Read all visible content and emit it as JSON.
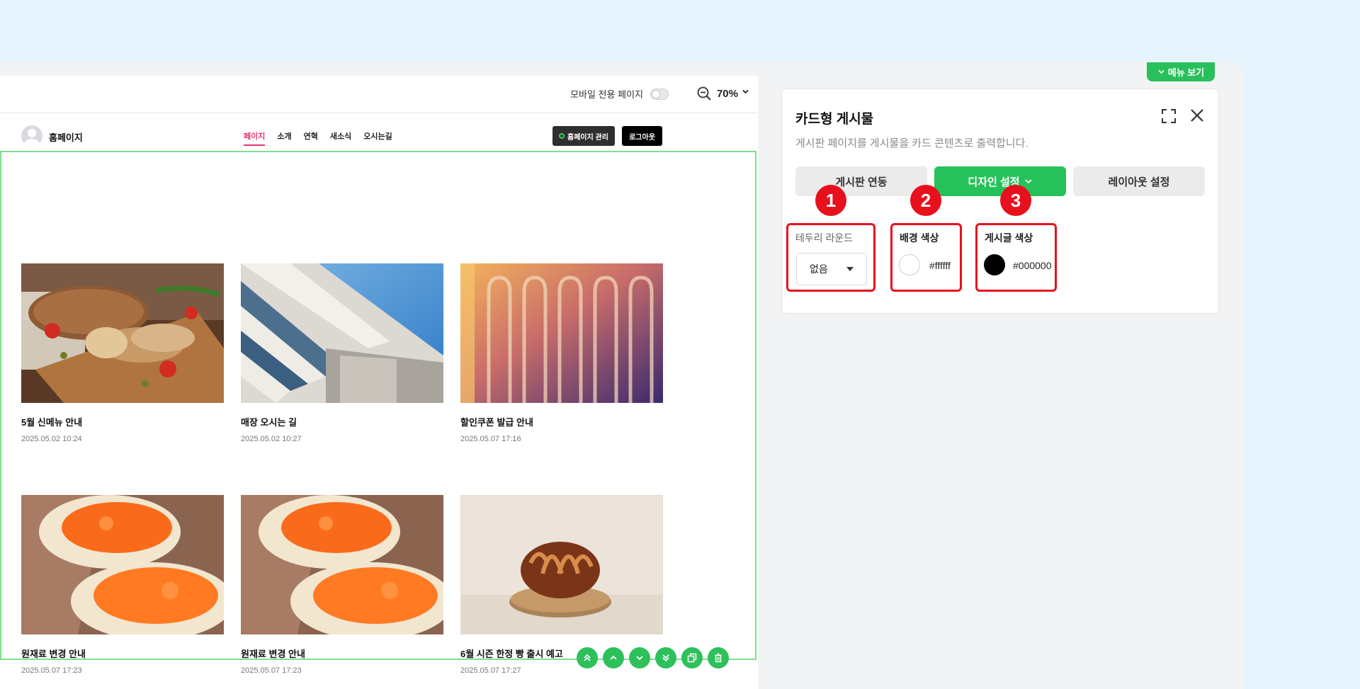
{
  "topbar": {
    "mobile_only_label": "모바일 전용 페이지",
    "zoom_level": "70%"
  },
  "site": {
    "title": "홈페이지",
    "nav": [
      "페이지",
      "소개",
      "연혁",
      "새소식",
      "오시는길"
    ],
    "admin_button": "홈페이지 관리",
    "logout_button": "로그아웃"
  },
  "cards": [
    {
      "title": "5월 신메뉴 안내",
      "date": "2025.05.02 10:24",
      "image": "bread-board"
    },
    {
      "title": "매장 오시는 길",
      "date": "2025.05.02 10:27",
      "image": "building"
    },
    {
      "title": "할인쿠폰 발급 안내",
      "date": "2025.05.07 17:16",
      "image": "neon-abstract"
    },
    {
      "title": "원재료 변경 안내",
      "date": "2025.05.07 17:23",
      "image": "jam-toast"
    },
    {
      "title": "원재료 변경 안내",
      "date": "2025.05.07 17:23",
      "image": "jam-toast"
    },
    {
      "title": "6월 시즌 한정 빵 출시 예고",
      "date": "2025.05.07 17:27",
      "image": "croissant"
    }
  ],
  "panel": {
    "menu_view_button": "메뉴 보기",
    "title": "카드형 게시물",
    "description": "게시판 페이지를 게시물을 카드 콘텐츠로 출력합니다.",
    "tabs": [
      "게시판 연동",
      "디자인 설정",
      "레이아웃 설정"
    ],
    "options": {
      "border_round": {
        "label": "테두리 라운드",
        "value": "없음"
      },
      "background_color": {
        "label": "배경 색상",
        "value": "#ffffff"
      },
      "text_color": {
        "label": "게시글 색상",
        "value": "#000000"
      }
    },
    "badges": [
      "1",
      "2",
      "3"
    ]
  },
  "colors": {
    "accent_green": "#27c15a",
    "highlight_red": "#e8101d",
    "nav_active_pink": "#e5356f"
  }
}
